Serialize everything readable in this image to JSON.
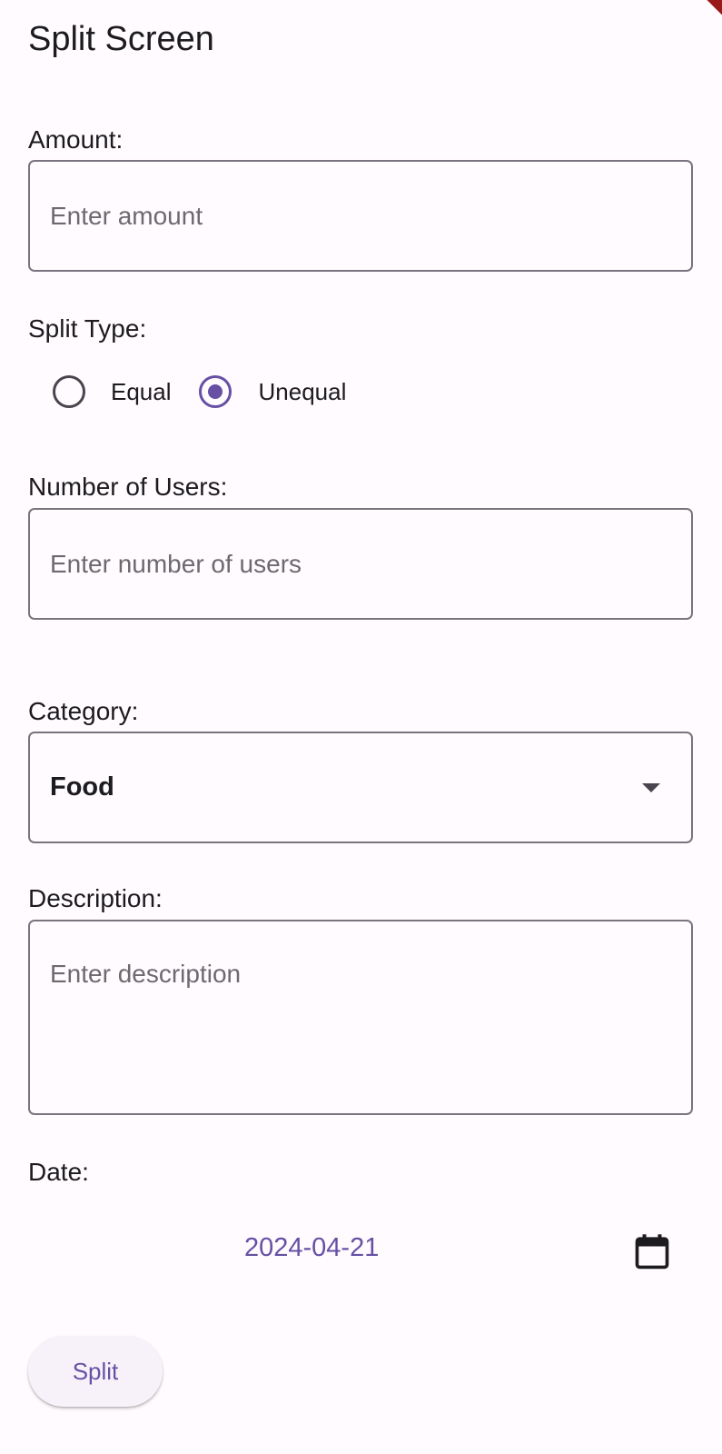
{
  "app": {
    "title": "Split Screen"
  },
  "amount": {
    "label": "Amount:",
    "value": "",
    "placeholder": "Enter amount"
  },
  "split_type": {
    "label": "Split Type:",
    "options": [
      {
        "label": "Equal",
        "selected": false
      },
      {
        "label": "Unequal",
        "selected": true
      }
    ]
  },
  "users": {
    "label": "Number of Users:",
    "value": "",
    "placeholder": "Enter number of users"
  },
  "category": {
    "label": "Category:",
    "selected": "Food"
  },
  "description": {
    "label": "Description:",
    "value": "",
    "placeholder": "Enter description"
  },
  "date": {
    "label": "Date:",
    "value": "2024-04-21",
    "icon": "calendar-icon"
  },
  "actions": {
    "split_label": "Split"
  },
  "colors": {
    "accent": "#6750a4",
    "outline": "#79747e",
    "background": "#fffbfe",
    "debug_banner": "#9a1a1a"
  }
}
